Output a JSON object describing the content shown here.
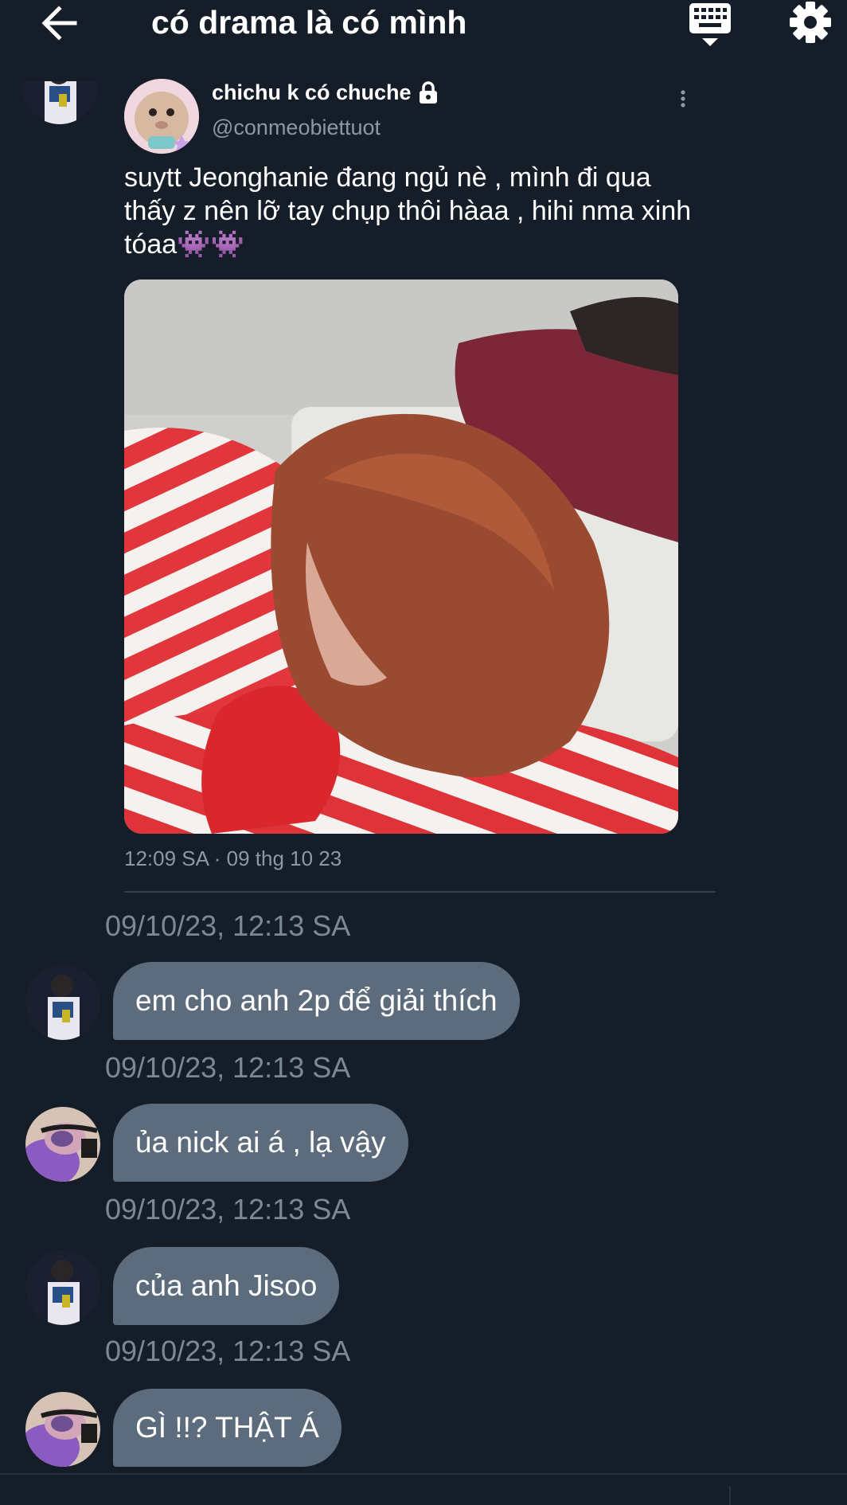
{
  "header": {
    "title": "có drama là có mình",
    "back_icon": "arrow-left-icon",
    "keyboard_icon": "keyboard-icon",
    "settings_icon": "gear-icon"
  },
  "tweet": {
    "display_name": "chichu k có chuche",
    "lock_icon": "lock-icon",
    "handle": "@conmeobiettuot",
    "text": "suytt Jeonghanie đang ngủ nè , mình đi qua thấy z nên lỡ tay chụp thôi hàaa , hihi nma xinh tóaa👾👾",
    "time": "12:09 SA · 09 thg 10 23",
    "more_icon": "more-vertical-icon"
  },
  "messages": [
    {
      "timestamp": "09/10/23, 12:13 SA"
    },
    {
      "text": "em cho anh 2p để giải thích",
      "timestamp": "09/10/23, 12:13 SA"
    },
    {
      "text": "ủa nick ai á , lạ vậy",
      "timestamp": "09/10/23, 12:13 SA"
    },
    {
      "text": "của anh Jisoo",
      "timestamp": "09/10/23, 12:13 SA"
    },
    {
      "text": "GÌ !!? THẬT Á"
    }
  ],
  "colors": {
    "background": "#151d28",
    "bubble": "#5d6c7d",
    "muted_text": "#7b8896"
  }
}
